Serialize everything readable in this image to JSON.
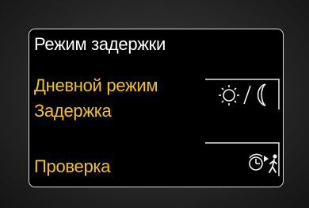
{
  "screen": {
    "title": "Режим задержки",
    "items": [
      {
        "label": "Дневной режим",
        "icon": "sun-moon-icon"
      },
      {
        "label": "Задержка"
      },
      {
        "label": "Проверка",
        "icon": "timer-walking-person-icon"
      }
    ]
  },
  "colors": {
    "background": "#000000",
    "title": "#ffffff",
    "item_label": "#f2c21b",
    "frame": "#d8d8d8"
  }
}
